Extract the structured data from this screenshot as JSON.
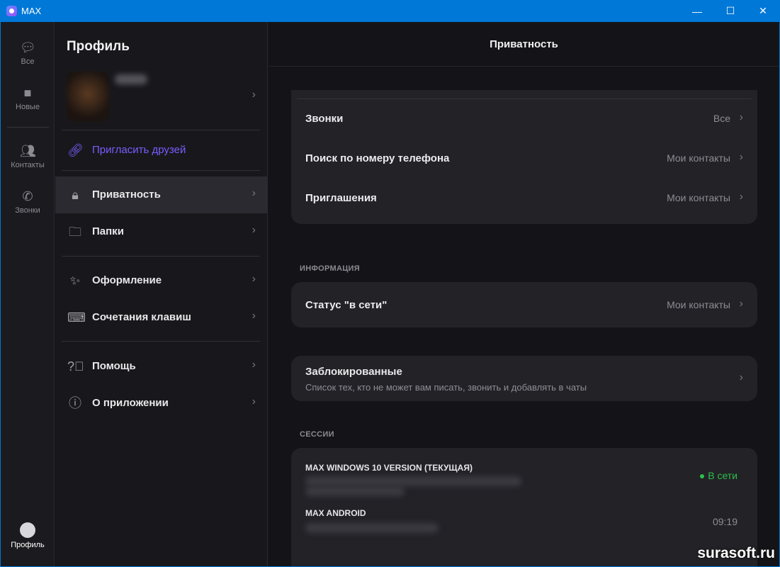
{
  "window": {
    "title": "MAX",
    "minimize": "—",
    "maximize": "☐",
    "close": "✕"
  },
  "rail": {
    "items": [
      {
        "label": "Все"
      },
      {
        "label": "Новые"
      },
      {
        "label": "Контакты"
      },
      {
        "label": "Звонки"
      }
    ],
    "profile": "Профиль"
  },
  "profile": {
    "title": "Профиль",
    "invite": "Пригласить друзей",
    "menu": [
      {
        "label": "Приватность"
      },
      {
        "label": "Папки"
      },
      {
        "label": "Оформление"
      },
      {
        "label": "Сочетания клавиш"
      },
      {
        "label": "Помощь"
      },
      {
        "label": "О приложении"
      }
    ]
  },
  "privacy": {
    "title": "Приватность",
    "rows": [
      {
        "label": "Звонки",
        "value": "Все"
      },
      {
        "label": "Поиск по номеру телефона",
        "value": "Мои контакты"
      },
      {
        "label": "Приглашения",
        "value": "Мои контакты"
      }
    ],
    "info_header": "ИНФОРМАЦИЯ",
    "status": {
      "label": "Статус \"в сети\"",
      "value": "Мои контакты"
    },
    "blocked": {
      "label": "Заблокированные",
      "desc": "Список тех, кто не может вам писать, звонить и добавлять в чаты"
    },
    "sessions_header": "СЕССИИ",
    "sessions": [
      {
        "name": "MAX WINDOWS 10 VERSION (ТЕКУЩАЯ)",
        "status": "В сети"
      },
      {
        "name": "MAX ANDROID",
        "status": "09:19"
      }
    ]
  },
  "colors": {
    "accent": "#7b5cff",
    "online": "#2fbf4a",
    "titlebar": "#0078d7"
  },
  "watermark": "surasoft.ru"
}
